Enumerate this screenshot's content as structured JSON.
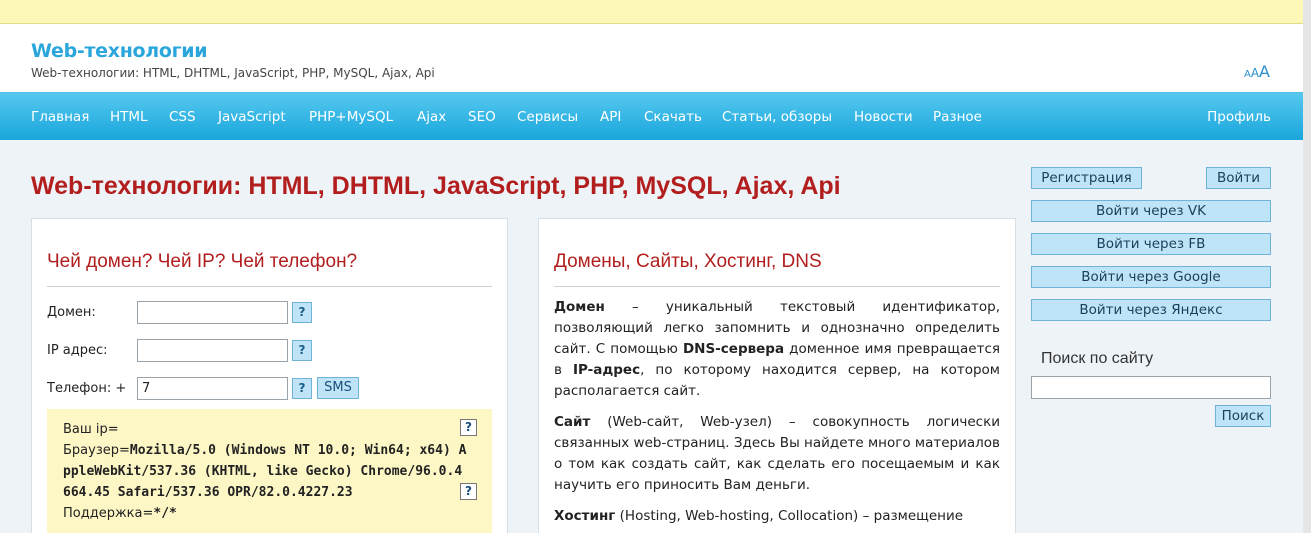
{
  "header": {
    "site_title": "Web-технологии",
    "site_subtitle": "Web-технологии: HTML, DHTML, JavaScript, PHP, MySQL, Ajax, Api",
    "font_size_letters": [
      "A",
      "A",
      "A"
    ]
  },
  "nav": {
    "items": [
      "Главная",
      "HTML",
      "CSS",
      "JavaScript",
      "PHP+MySQL",
      "Ajax",
      "SEO",
      "Сервисы",
      "API",
      "Скачать",
      "Статьи, обзоры",
      "Новости",
      "Разное"
    ],
    "profile": "Профиль"
  },
  "page_title": "Web-технологии: HTML, DHTML, JavaScript, PHP, MySQL, Ajax, Api",
  "lookup": {
    "title": "Чей домен? Чей IP? Чей телефон?",
    "domain_label": "Домен:",
    "domain_value": "",
    "ip_label": "IP адрес:",
    "ip_value": "",
    "phone_label": "Телефон: +",
    "phone_value": "7",
    "help_glyph": "?",
    "sms_label": "SMS",
    "your_ip_label": "Ваш ip=",
    "browser_label": "Браузер=",
    "browser_value": "Mozilla/5.0 (Windows NT 10.0; Win64; x64) AppleWebKit/537.36 (KHTML, like Gecko) Chrome/96.0.4664.45 Safari/537.36 OPR/82.0.4227.23",
    "support_label": "Поддержка=",
    "support_value": "*/*"
  },
  "article": {
    "title": "Домены, Сайты, Хостинг, DNS",
    "p1_b1": "Домен",
    "p1_t1": " – уникальный текстовый идентификатор, позволяющий легко запомнить и однозначно определить сайт. С помощью ",
    "p1_b2": "DNS-сервера",
    "p1_t2": " доменное имя превращается в ",
    "p1_b3": "IP-адрес",
    "p1_t3": ", по которому находится сервер, на котором располагается сайт.",
    "p2_b1": "Сайт",
    "p2_t1": " (Web-сайт, Web-узел) – совокупность логически связанных web-страниц. Здесь Вы найдете много материалов о том как создать сайт, как сделать его посещаемым и как научить его приносить Вам деньги.",
    "p3_b1": "Хостинг",
    "p3_t1": " (Hosting, Web-hosting, Collocation) – размещение"
  },
  "sidebar": {
    "register": "Регистрация",
    "login": "Войти",
    "login_vk": "Войти через VK",
    "login_fb": "Войти через FB",
    "login_google": "Войти через Google",
    "login_yandex": "Войти через Яндекс",
    "search_title": "Поиск по сайту",
    "search_value": "",
    "search_button": "Поиск"
  },
  "colors": {
    "nav_top": "#56c8ef",
    "nav_bottom": "#19a6dc",
    "title_red": "#b21e1e",
    "brand_blue": "#2aa6dc",
    "info_yellow": "#fdf7c6"
  }
}
